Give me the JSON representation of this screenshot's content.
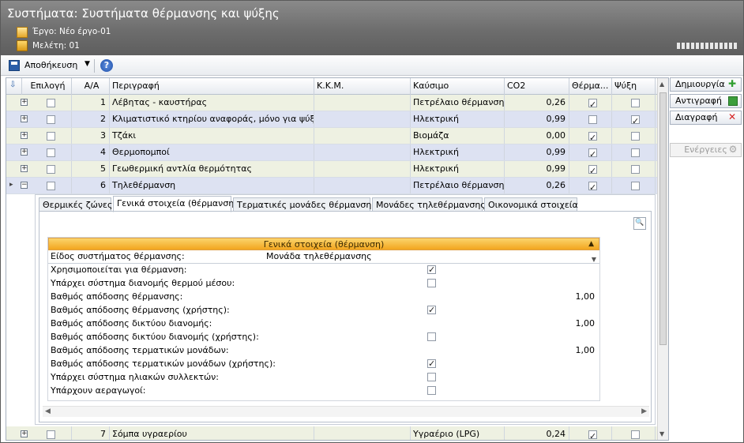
{
  "window": {
    "title": "Συστήματα: Συστήματα θέρμανσης και ψύξης",
    "project_label": "Έργο: Νέο έργο-01",
    "study_label": "Μελέτη: 01"
  },
  "toolbar": {
    "save_label": "Αποθήκευση"
  },
  "grid": {
    "columns": [
      "Επιλογή",
      "Α/Α",
      "Περιγραφή",
      "Κ.Κ.Μ.",
      "Καύσιμο",
      "CO2",
      "Θέρμα...",
      "Ψύξη"
    ],
    "rows": [
      {
        "aa": "1",
        "desc": "Λέβητας - καυστήρας",
        "kkm": "",
        "fuel": "Πετρέλαιο θέρμανσης",
        "co2": "0,26",
        "heat": true,
        "cool": false
      },
      {
        "aa": "2",
        "desc": "Κλιματιστικό κτηρίου αναφοράς, μόνο για ψύξη",
        "kkm": "",
        "fuel": "Ηλεκτρική",
        "co2": "0,99",
        "heat": false,
        "cool": true
      },
      {
        "aa": "3",
        "desc": "Τζάκι",
        "kkm": "",
        "fuel": "Βιομάζα",
        "co2": "0,00",
        "heat": true,
        "cool": false
      },
      {
        "aa": "4",
        "desc": "Θερμοπομποί",
        "kkm": "",
        "fuel": "Ηλεκτρική",
        "co2": "0,99",
        "heat": true,
        "cool": false
      },
      {
        "aa": "5",
        "desc": "Γεωθερμική αντλία θερμότητας",
        "kkm": "",
        "fuel": "Ηλεκτρική",
        "co2": "0,99",
        "heat": true,
        "cool": false
      },
      {
        "aa": "6",
        "desc": "Τηλεθέρμανση",
        "kkm": "",
        "fuel": "Πετρέλαιο θέρμανσης",
        "co2": "0,26",
        "heat": true,
        "cool": false
      }
    ],
    "last_row": {
      "aa": "7",
      "desc": "Σόμπα υγραερίου",
      "kkm": "",
      "fuel": "Υγραέριο (LPG)",
      "co2": "0,24",
      "heat": true,
      "cool": false
    }
  },
  "detail": {
    "tabs": [
      "Θερμικές ζώνες",
      "Γενικά στοιχεία (θέρμανση)",
      "Τερματικές μονάδες θέρμανσης",
      "Μονάδες τηλεθέρμανσης",
      "Οικονομικά στοιχεία"
    ],
    "active_tab": "Γενικά στοιχεία (θέρμανση)",
    "panel_title": "Γενικά στοιχεία (θέρμανση)",
    "type_label": "Είδος συστήματος θέρμανσης:",
    "type_value": "Μονάδα τηλεθέρμανσης",
    "properties": [
      {
        "label": "Χρησιμοποιείται για θέρμανση:",
        "kind": "check",
        "checked": true
      },
      {
        "label": "Υπάρχει σύστημα διανομής θερμού μέσου:",
        "kind": "check",
        "checked": false
      },
      {
        "label": "Βαθμός απόδοσης θέρμανσης:",
        "kind": "num",
        "value": "1,00"
      },
      {
        "label": "Βαθμός απόδοσης θέρμανσης (χρήστης):",
        "kind": "check",
        "checked": true
      },
      {
        "label": "Βαθμός απόδοσης δικτύου διανομής:",
        "kind": "num",
        "value": "1,00"
      },
      {
        "label": "Βαθμός απόδοσης δικτύου διανομής (χρήστης):",
        "kind": "check",
        "checked": false
      },
      {
        "label": "Βαθμός απόδοσης τερματικών μονάδων:",
        "kind": "num",
        "value": "1,00"
      },
      {
        "label": "Βαθμός απόδοσης τερματικών μονάδων (χρήστης):",
        "kind": "check",
        "checked": true
      },
      {
        "label": "Υπάρχει σύστημα ηλιακών συλλεκτών:",
        "kind": "check",
        "checked": false
      },
      {
        "label": "Υπάρχουν αεραγωγοί:",
        "kind": "check",
        "checked": false
      }
    ]
  },
  "sidebar": {
    "create": "Δημιουργία",
    "copy": "Αντιγραφή",
    "delete": "Διαγραφή",
    "actions": "Ενέργειες"
  }
}
